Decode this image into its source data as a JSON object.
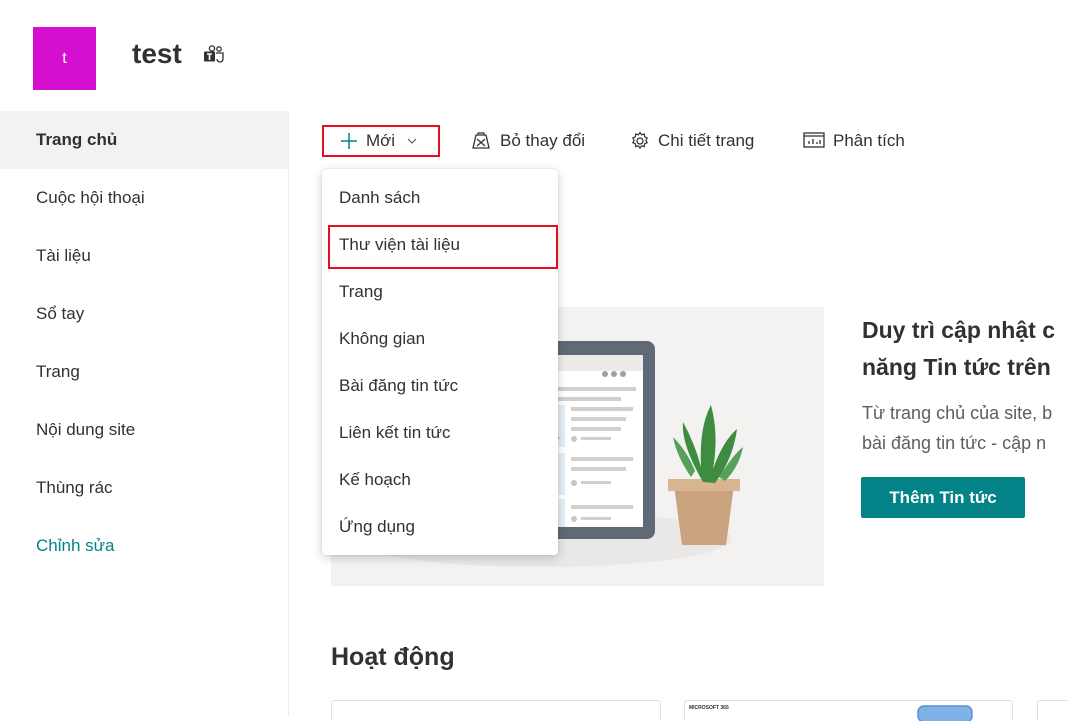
{
  "site": {
    "logo_letter": "t",
    "logo_color": "#d40fcf",
    "title": "test",
    "teams_icon": "teams-icon"
  },
  "sidebar": {
    "items": [
      {
        "label": "Trang chủ",
        "active": true
      },
      {
        "label": "Cuộc hội thoại"
      },
      {
        "label": "Tài liệu"
      },
      {
        "label": "Sổ tay"
      },
      {
        "label": "Trang"
      },
      {
        "label": "Nội dung site"
      },
      {
        "label": "Thùng rác"
      }
    ],
    "edit_label": "Chỉnh sửa"
  },
  "toolbar": {
    "new_label": "Mới",
    "discard_label": "Bỏ thay đổi",
    "page_details_label": "Chi tiết trang",
    "analytics_label": "Phân tích"
  },
  "new_menu": {
    "items": [
      "Danh sách",
      "Thư viện tài liệu",
      "Trang",
      "Không gian",
      "Bài đăng tin tức",
      "Liên kết tin tức",
      "Kế hoạch",
      "Ứng dụng"
    ],
    "highlighted": "Thư viện tài liệu"
  },
  "news": {
    "title_line1": "Duy trì cập nhật c",
    "title_line2": "năng Tin tức trên",
    "text_line1": "Từ trang chủ của site, b",
    "text_line2": "bài đăng tin tức - cập n",
    "button_label": "Thêm Tin tức"
  },
  "activity": {
    "title": "Hoạt động",
    "card_label": "MICROSOFT 365"
  },
  "colors": {
    "accent": "#038387",
    "highlight_border": "#e0101e"
  }
}
